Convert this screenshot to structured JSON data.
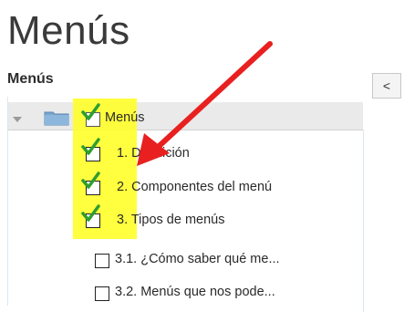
{
  "page": {
    "title": "Menús"
  },
  "panel": {
    "title": "Menús",
    "collapse_label": "<"
  },
  "tree": {
    "root_label": "Menús",
    "items": [
      {
        "label": "1. Definición",
        "checked": true
      },
      {
        "label": "2. Componentes del menú",
        "checked": true
      },
      {
        "label": "3. Tipos de menús",
        "checked": true
      },
      {
        "label": "3.1. ¿Cómo saber qué me...",
        "checked": false
      },
      {
        "label": "3.2. Menús que nos pode...",
        "checked": false
      }
    ]
  },
  "colors": {
    "highlight": "#ffff2a",
    "checkmark": "#2e9e2e",
    "arrow": "#e82020",
    "folder": "#7aa6cf"
  },
  "icons": {
    "toggle": "triangle-down-icon",
    "folder": "folder-icon",
    "check": "green-check-icon",
    "annotation": "red-arrow-icon"
  }
}
